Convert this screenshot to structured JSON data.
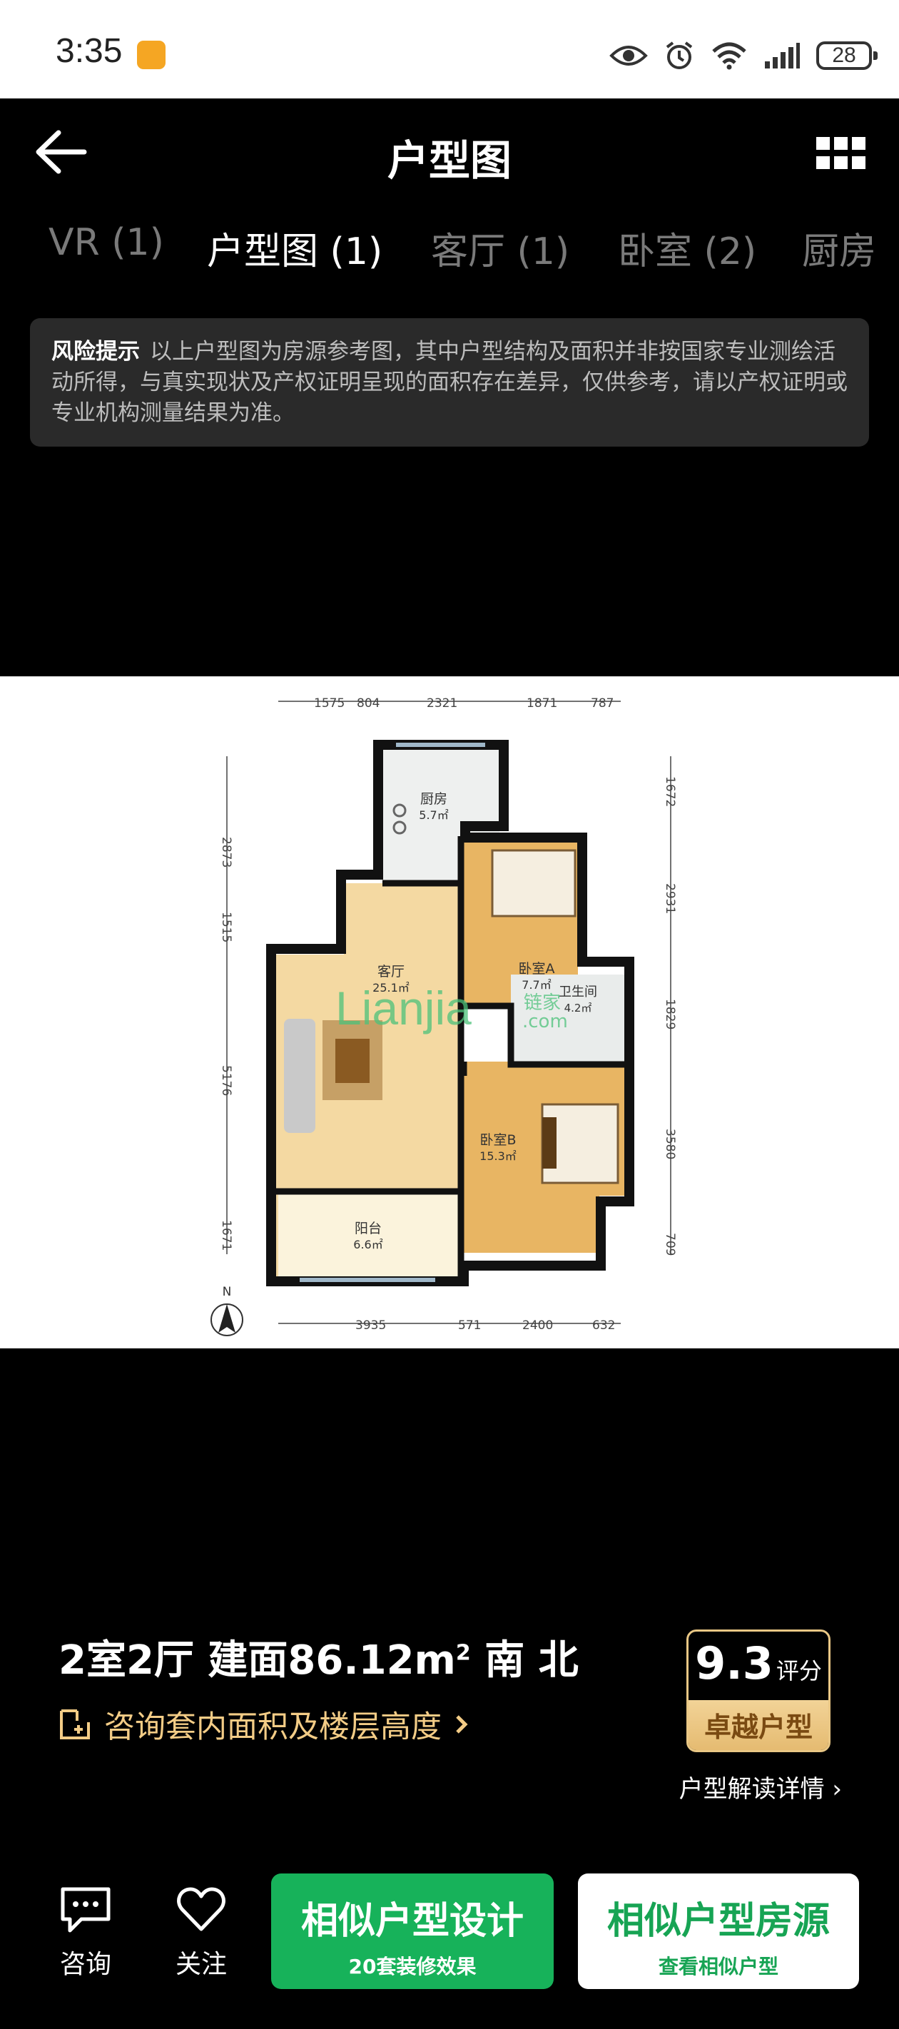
{
  "status_bar": {
    "time": "3:35",
    "battery": "28"
  },
  "header": {
    "title": "户型图"
  },
  "tabs": [
    {
      "label": "VR (1)"
    },
    {
      "label": "户型图 (1)"
    },
    {
      "label": "客厅 (1)"
    },
    {
      "label": "卧室 (2)"
    },
    {
      "label": "厨房"
    }
  ],
  "notice": {
    "label": "风险提示",
    "text": "以上户型图为房源参考图，其中户型结构及面积并非按国家专业测绘活动所得，与真实现状及产权证明呈现的面积存在差异，仅供参考，请以产权证明或专业机构测量结果为准。"
  },
  "floorplan": {
    "top_dims": [
      "1575",
      "804",
      "2321",
      "1871",
      "787"
    ],
    "bottom_dims": [
      "3935",
      "571",
      "2400",
      "632"
    ],
    "left_dims": [
      "2873",
      "1515",
      "5176",
      "1671"
    ],
    "right_dims": [
      "1672",
      "2931",
      "1829",
      "3580",
      "709"
    ],
    "rooms": {
      "kitchen_name": "厨房",
      "kitchen_area": "5.7㎡",
      "bedroom_a_name": "卧室A",
      "bedroom_a_area": "7.7㎡",
      "living_name": "客厅",
      "living_area": "25.1㎡",
      "bath_name": "卫生间",
      "bath_area": "4.2㎡",
      "bedroom_b_name": "卧室B",
      "bedroom_b_area": "15.3㎡",
      "balcony_name": "阳台",
      "balcony_area": "6.6㎡"
    },
    "watermark_latin": "Lianjia",
    "watermark_cn": "链家",
    "watermark_com": ".com",
    "north": "N"
  },
  "listing": {
    "title_prefix": "2室2厅 建面86.12m",
    "title_sup": "2",
    "title_suffix": " 南 北",
    "consult_link": "咨询套内面积及楼层高度",
    "score": "9.3",
    "score_label": "评分",
    "score_badge": "卓越户型",
    "detail_link": "户型解读详情 ›"
  },
  "bottom_bar": {
    "consult": "咨询",
    "follow": "关注",
    "design_btn": "相似户型设计",
    "design_sub": "20套装修效果",
    "source_btn": "相似户型房源",
    "source_sub": "查看相似户型"
  },
  "colors": {
    "accent_green": "#17b25a",
    "gold": "#f3cc86"
  }
}
